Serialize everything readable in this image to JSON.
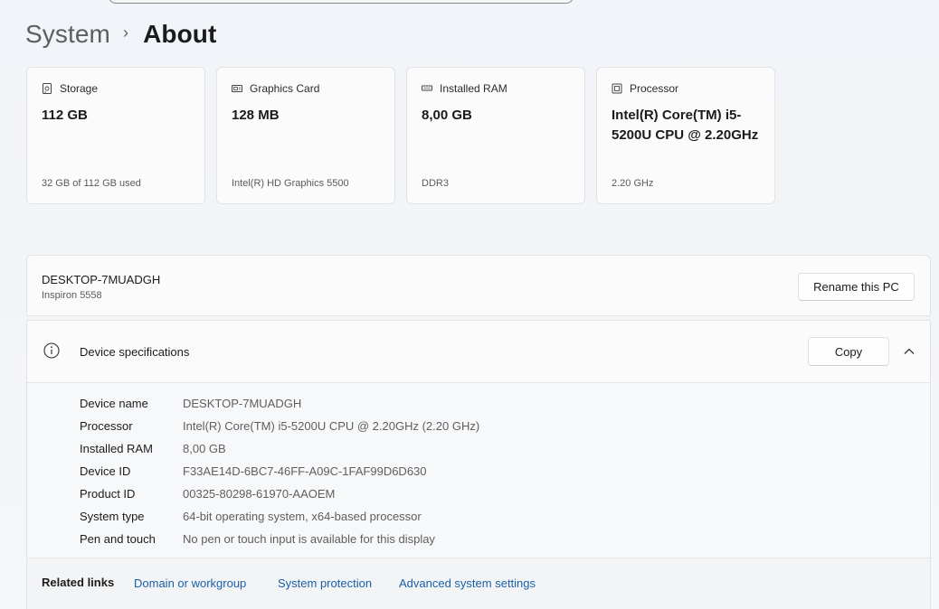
{
  "breadcrumb": {
    "parent": "System",
    "separator": "›",
    "current": "About"
  },
  "cards": [
    {
      "icon": "storage-icon",
      "title": "Storage",
      "value": "112 GB",
      "sub": "32 GB of 112 GB used"
    },
    {
      "icon": "graphics-card-icon",
      "title": "Graphics Card",
      "value": "128 MB",
      "sub": "Intel(R) HD Graphics 5500"
    },
    {
      "icon": "ram-icon",
      "title": "Installed RAM",
      "value": "8,00 GB",
      "sub": "DDR3"
    },
    {
      "icon": "processor-icon",
      "title": "Processor",
      "value": "Intel(R) Core(TM) i5-5200U CPU @ 2.20GHz",
      "sub": "2.20 GHz"
    }
  ],
  "pc": {
    "name": "DESKTOP-7MUADGH",
    "model": "Inspiron 5558",
    "rename_label": "Rename this PC"
  },
  "specs": {
    "title": "Device specifications",
    "copy_label": "Copy",
    "rows": [
      {
        "label": "Device name",
        "value": "DESKTOP-7MUADGH"
      },
      {
        "label": "Processor",
        "value": "Intel(R) Core(TM) i5-5200U CPU @ 2.20GHz (2.20 GHz)"
      },
      {
        "label": "Installed RAM",
        "value": "8,00 GB"
      },
      {
        "label": "Device ID",
        "value": "F33AE14D-6BC7-46FF-A09C-1FAF99D6D630"
      },
      {
        "label": "Product ID",
        "value": "00325-80298-61970-AAOEM"
      },
      {
        "label": "System type",
        "value": "64-bit operating system, x64-based processor"
      },
      {
        "label": "Pen and touch",
        "value": "No pen or touch input is available for this display"
      }
    ]
  },
  "related": {
    "label": "Related links",
    "links": [
      "Domain or workgroup",
      "System protection",
      "Advanced system settings"
    ]
  },
  "colors": {
    "link": "#1a5fa8",
    "card_bg": "#fbfbfc",
    "page_bg": "#f3f5f8"
  }
}
